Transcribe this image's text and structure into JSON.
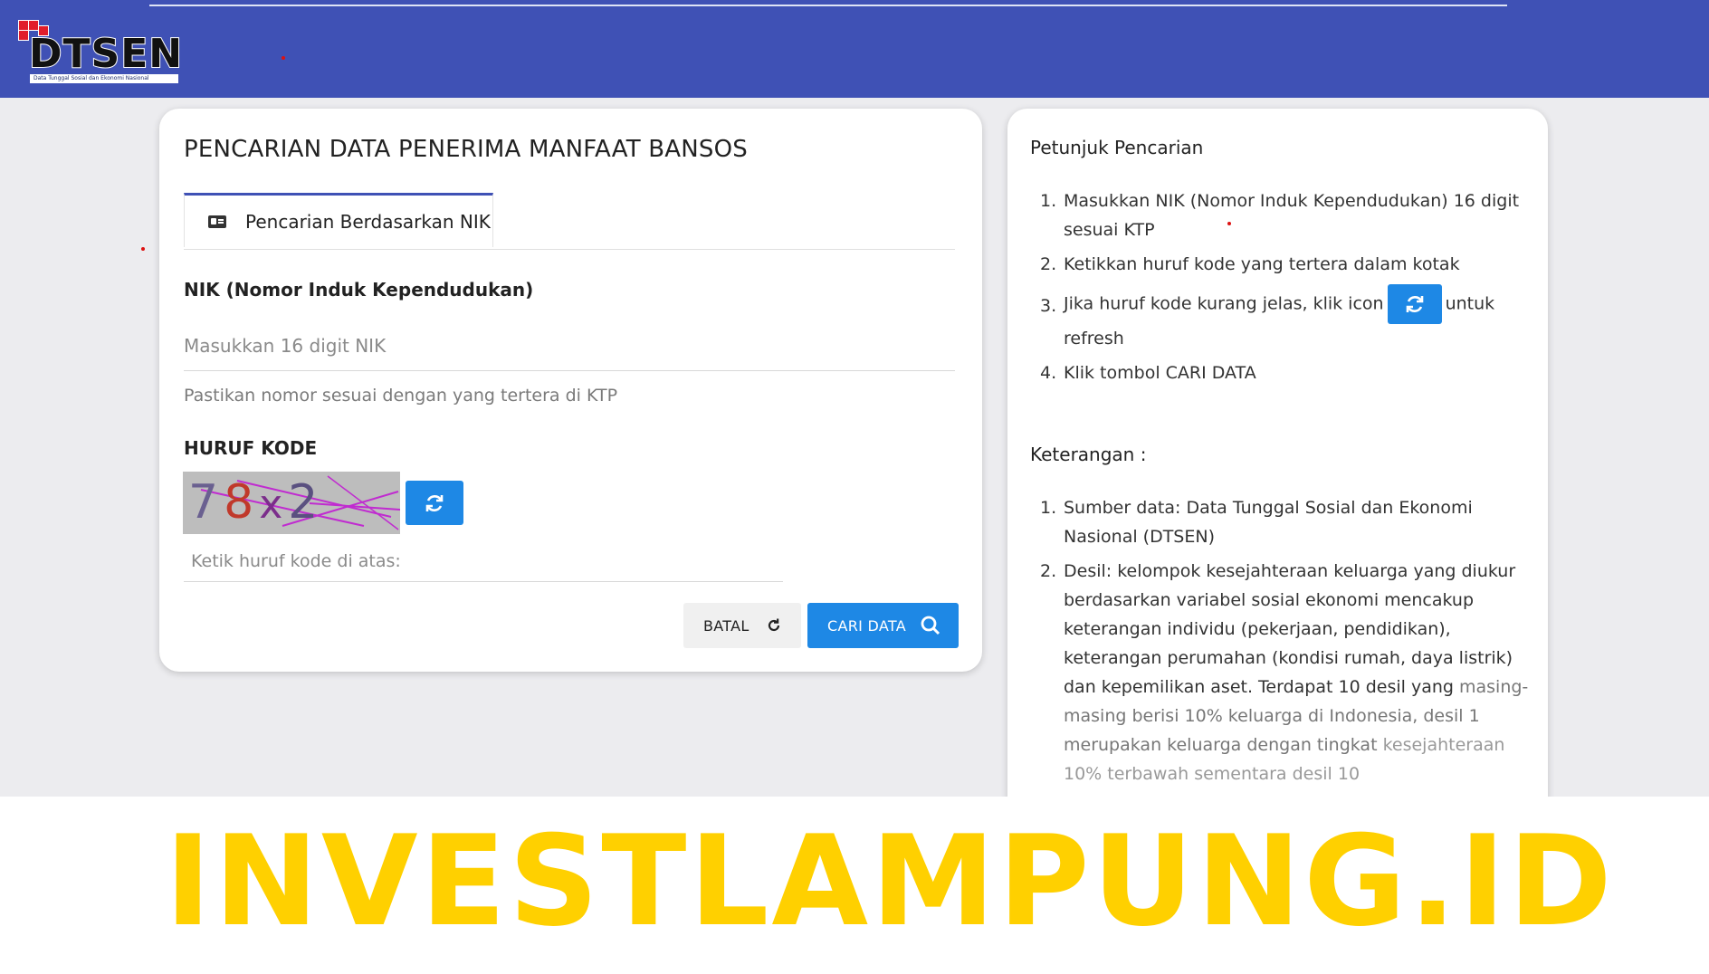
{
  "header": {
    "logo_text": "DTSEN",
    "logo_subtitle": "Data Tunggal Sosial dan Ekonomi Nasional"
  },
  "search": {
    "title": "PENCARIAN DATA PENERIMA MANFAAT BANSOS",
    "tab_label": "Pencarian Berdasarkan NIK",
    "nik_label": "NIK (Nomor Induk Kependudukan)",
    "nik_placeholder": "Masukkan 16 digit NIK",
    "nik_hint": "Pastikan nomor sesuai dengan yang tertera di KTP",
    "captcha_label": "HURUF KODE",
    "captcha_text": "78x2",
    "captcha_placeholder": "Ketik huruf kode di atas:",
    "cancel_label": "BATAL",
    "submit_label": "CARI DATA"
  },
  "guide": {
    "title": "Petunjuk Pencarian",
    "steps": [
      "Masukkan NIK (Nomor Induk Kependudukan) 16 digit sesuai KTP",
      "Ketikkan huruf kode yang tertera dalam kotak",
      "Jika huruf kode kurang jelas, klik icon",
      "untuk refresh",
      "Klik tombol CARI DATA"
    ],
    "notes_title": "Keterangan :",
    "notes": [
      "Sumber data: Data Tunggal Sosial dan Ekonomi Nasional (DTSEN)",
      "Desil: kelompok kesejahteraan keluarga yang diukur berdasarkan variabel sosial ekonomi mencakup keterangan individu (pekerjaan, pendidikan), keterangan perumahan (kondisi rumah, daya listrik) dan kepemilikan aset. Terdapat 10 desil yang",
      "masing-masing berisi 10% keluarga di Indonesia, desil 1 merupakan keluarga dengan tingkat",
      "kesejahteraan 10% terbawah sementara desil 10"
    ]
  },
  "watermark": "INVESTLAMPUNG.ID",
  "colors": {
    "header": "#3f51b5",
    "accent": "#1e88e5",
    "watermark": "#ffd000"
  }
}
